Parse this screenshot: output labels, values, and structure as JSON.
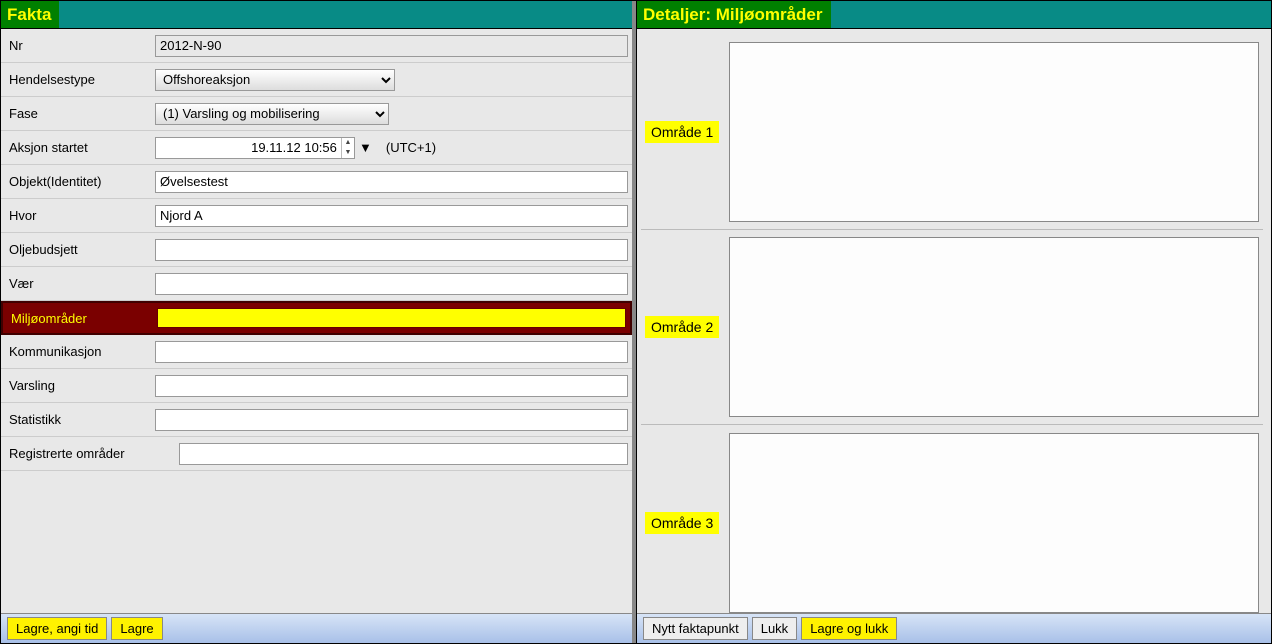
{
  "left": {
    "title": "Fakta",
    "fields": {
      "nr_label": "Nr",
      "nr_value": "2012-N-90",
      "hendelsestype_label": "Hendelsestype",
      "hendelsestype_value": "Offshoreaksjon",
      "fase_label": "Fase",
      "fase_value": "(1) Varsling og mobilisering",
      "aksjon_startet_label": "Aksjon startet",
      "aksjon_startet_value": "19.11.12 10:56",
      "utc": "(UTC+1)",
      "objekt_label": "Objekt(Identitet)",
      "objekt_value": "Øvelsestest",
      "hvor_label": "Hvor",
      "hvor_value": "Njord A",
      "oljebudsjett_label": "Oljebudsjett",
      "oljebudsjett_value": "",
      "vaer_label": "Vær",
      "vaer_value": "",
      "miljo_label": "Miljøområder",
      "miljo_value": "",
      "kommunikasjon_label": "Kommunikasjon",
      "kommunikasjon_value": "",
      "varsling_label": "Varsling",
      "varsling_value": "",
      "statistikk_label": "Statistikk",
      "statistikk_value": "",
      "registrerte_label": "Registrerte områder",
      "registrerte_value": ""
    },
    "footer": {
      "lagre_tid": "Lagre, angi tid",
      "lagre": "Lagre"
    }
  },
  "right": {
    "title": "Detaljer: Miljøområder",
    "areas": {
      "a1": "Område 1",
      "a2": "Område 2",
      "a3": "Område 3"
    },
    "footer": {
      "nytt": "Nytt faktapunkt",
      "lukk": "Lukk",
      "lagre_lukk": "Lagre og lukk"
    }
  }
}
